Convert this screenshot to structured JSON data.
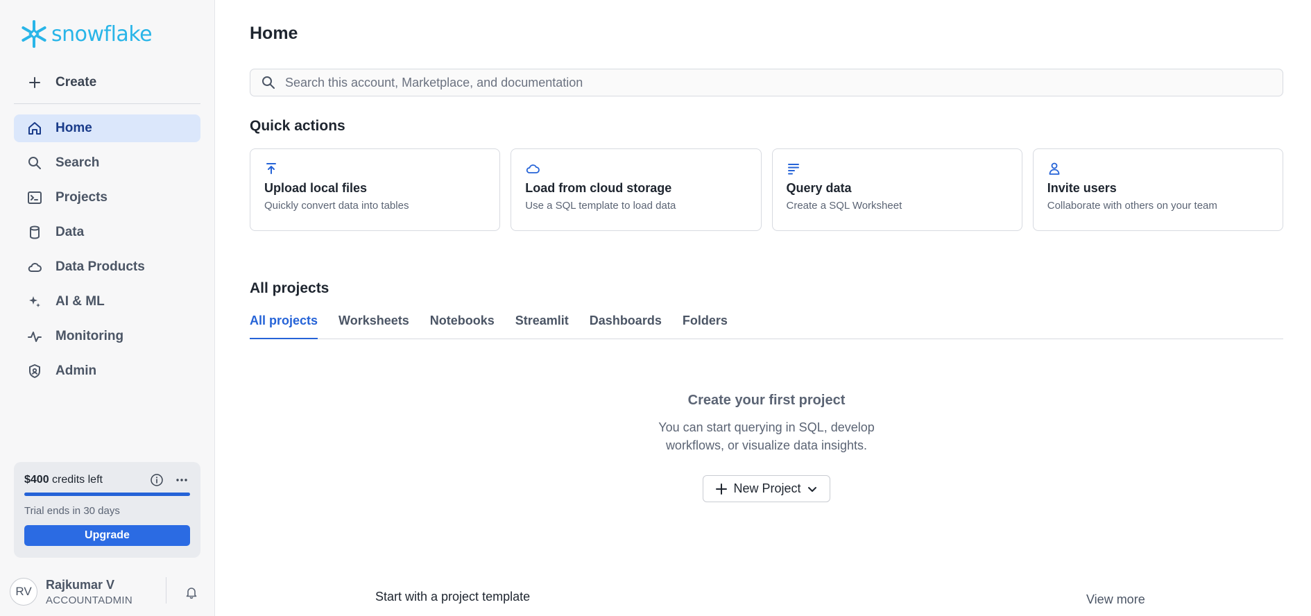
{
  "brand": {
    "name": "snowflake",
    "color": "#29b5e8"
  },
  "sidebar": {
    "create_label": "Create",
    "items": [
      {
        "label": "Home",
        "icon": "home-icon",
        "active": true
      },
      {
        "label": "Search",
        "icon": "search-icon"
      },
      {
        "label": "Projects",
        "icon": "terminal-icon"
      },
      {
        "label": "Data",
        "icon": "database-icon"
      },
      {
        "label": "Data Products",
        "icon": "cloud-icon"
      },
      {
        "label": "AI & ML",
        "icon": "sparkle-icon"
      },
      {
        "label": "Monitoring",
        "icon": "pulse-icon"
      },
      {
        "label": "Admin",
        "icon": "shield-icon"
      }
    ],
    "credits": {
      "amount": "$400",
      "suffix": " credits left",
      "progress": 1.0,
      "trial": "Trial ends in 30 days",
      "upgrade_label": "Upgrade"
    },
    "user": {
      "initials": "RV",
      "name": "Rajkumar V",
      "role": "ACCOUNTADMIN"
    }
  },
  "main": {
    "title": "Home",
    "search_placeholder": "Search this account, Marketplace, and documentation",
    "quick_actions_title": "Quick actions",
    "quick_actions": [
      {
        "title": "Upload local files",
        "subtitle": "Quickly convert data into tables",
        "icon": "upload-icon"
      },
      {
        "title": "Load from cloud storage",
        "subtitle": "Use a SQL template to load data",
        "icon": "cloud-icon"
      },
      {
        "title": "Query data",
        "subtitle": "Create a SQL Worksheet",
        "icon": "lines-icon"
      },
      {
        "title": "Invite users",
        "subtitle": "Collaborate with others on your team",
        "icon": "user-icon"
      }
    ],
    "projects_title": "All projects",
    "tabs": [
      {
        "label": "All projects",
        "active": true
      },
      {
        "label": "Worksheets"
      },
      {
        "label": "Notebooks"
      },
      {
        "label": "Streamlit"
      },
      {
        "label": "Dashboards"
      },
      {
        "label": "Folders"
      }
    ],
    "empty": {
      "title": "Create your first project",
      "description": "You can start querying in SQL, develop workflows, or visualize data insights.",
      "new_project_label": "New Project"
    },
    "template_label": "Start with a project template",
    "view_more_label": "View more"
  },
  "colors": {
    "accent": "#2563d7",
    "active_bg": "#dbe7fb",
    "upgrade": "#2b6be3"
  }
}
